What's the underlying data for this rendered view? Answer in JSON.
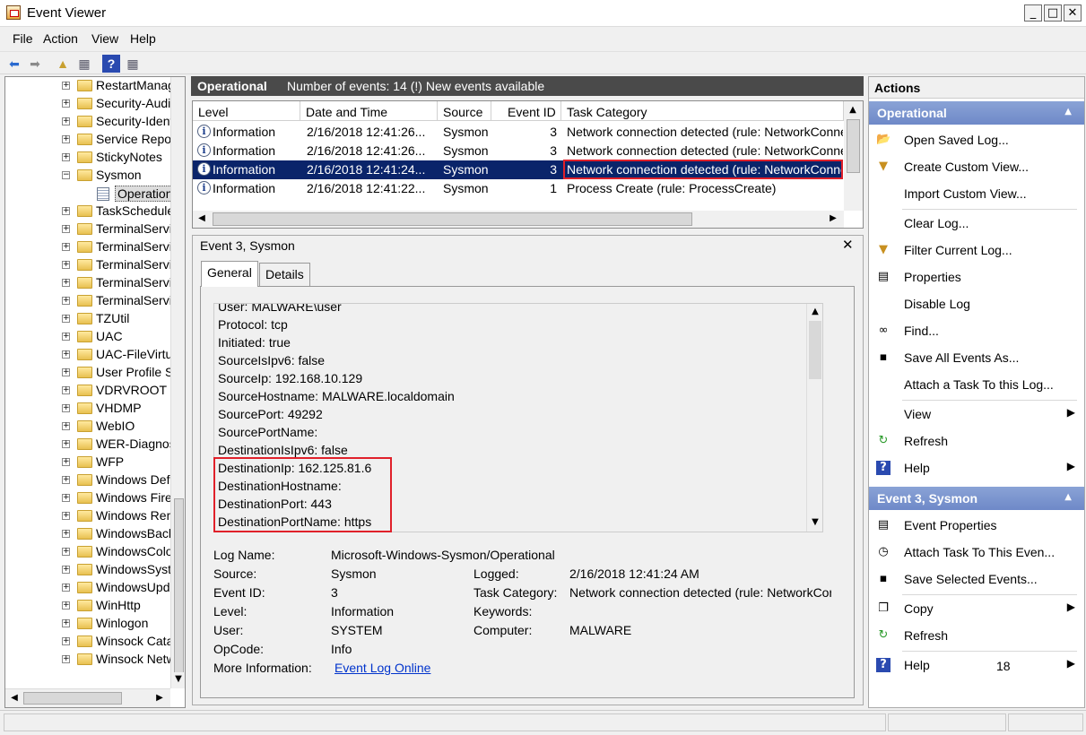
{
  "window": {
    "title": "Event Viewer"
  },
  "menu": [
    "File",
    "Action",
    "View",
    "Help"
  ],
  "tree": {
    "items": [
      {
        "label": "RestartManager",
        "expander": "+"
      },
      {
        "label": "Security-Auditing",
        "expander": "+"
      },
      {
        "label": "Security-IdentityListener",
        "expander": "+"
      },
      {
        "label": "Service Reporting API",
        "expander": "+"
      },
      {
        "label": "StickyNotes",
        "expander": "+"
      },
      {
        "label": "Sysmon",
        "expander": "−"
      },
      {
        "label": "Operational",
        "expander": ""
      },
      {
        "label": "TaskScheduler",
        "expander": "+"
      },
      {
        "label": "TerminalServices-ClientActiveX",
        "expander": "+"
      },
      {
        "label": "TerminalServices-ClientUSB",
        "expander": "+"
      },
      {
        "label": "TerminalServices-LocalSession",
        "expander": "+"
      },
      {
        "label": "TerminalServices-PnPDevices",
        "expander": "+"
      },
      {
        "label": "TerminalServices-RemoteConnection",
        "expander": "+"
      },
      {
        "label": "TZUtil",
        "expander": "+"
      },
      {
        "label": "UAC",
        "expander": "+"
      },
      {
        "label": "UAC-FileVirtualization",
        "expander": "+"
      },
      {
        "label": "User Profile Service",
        "expander": "+"
      },
      {
        "label": "VDRVROOT",
        "expander": "+"
      },
      {
        "label": "VHDMP",
        "expander": "+"
      },
      {
        "label": "WebIO",
        "expander": "+"
      },
      {
        "label": "WER-Diagnostics",
        "expander": "+"
      },
      {
        "label": "WFP",
        "expander": "+"
      },
      {
        "label": "Windows Defender",
        "expander": "+"
      },
      {
        "label": "Windows Firewall",
        "expander": "+"
      },
      {
        "label": "Windows Remote",
        "expander": "+"
      },
      {
        "label": "WindowsBackup",
        "expander": "+"
      },
      {
        "label": "WindowsColorSystem",
        "expander": "+"
      },
      {
        "label": "WindowsSystemAssessment",
        "expander": "+"
      },
      {
        "label": "WindowsUpdateClient",
        "expander": "+"
      },
      {
        "label": "WinHttp",
        "expander": "+"
      },
      {
        "label": "Winlogon",
        "expander": "+"
      },
      {
        "label": "Winsock Catalog",
        "expander": "+"
      },
      {
        "label": "Winsock Network",
        "expander": "+"
      }
    ]
  },
  "operational": {
    "title": "Operational",
    "count_text": "Number of events: 14 (!) New events available"
  },
  "event_list": {
    "columns": [
      "Level",
      "Date and Time",
      "Source",
      "Event ID",
      "Task Category"
    ],
    "rows": [
      {
        "level": "Information",
        "datetime": "2/16/2018 12:41:26...",
        "source": "Sysmon",
        "event_id": "3",
        "category": "Network connection detected (rule: NetworkConnect)"
      },
      {
        "level": "Information",
        "datetime": "2/16/2018 12:41:26...",
        "source": "Sysmon",
        "event_id": "3",
        "category": "Network connection detected (rule: NetworkConnect)"
      },
      {
        "level": "Information",
        "datetime": "2/16/2018 12:41:24...",
        "source": "Sysmon",
        "event_id": "3",
        "category": "Network connection detected (rule: NetworkConnect)"
      },
      {
        "level": "Information",
        "datetime": "2/16/2018 12:41:22...",
        "source": "Sysmon",
        "event_id": "1",
        "category": "Process Create (rule: ProcessCreate)"
      }
    ]
  },
  "detail": {
    "title": "Event 3, Sysmon",
    "tabs": [
      "General",
      "Details"
    ],
    "lines": [
      "User: MALWARE\\user",
      "Protocol: tcp",
      "Initiated: true",
      "SourceIsIpv6: false",
      "SourceIp: 192.168.10.129",
      "SourceHostname: MALWARE.localdomain",
      "SourcePort: 49292",
      "SourcePortName:",
      "DestinationIsIpv6: false",
      "DestinationIp: 162.125.81.6",
      "DestinationHostname:",
      "DestinationPort: 443",
      "DestinationPortName: https"
    ],
    "info": {
      "log_name_label": "Log Name:",
      "log_name": "Microsoft-Windows-Sysmon/Operational",
      "source_label": "Source:",
      "source": "Sysmon",
      "logged_label": "Logged:",
      "logged": "2/16/2018 12:41:24 AM",
      "event_id_label": "Event ID:",
      "event_id": "3",
      "task_label": "Task Category:",
      "task": "Network connection detected (rule: NetworkConnect)",
      "level_label": "Level:",
      "level": "Information",
      "keywords_label": "Keywords:",
      "user_label": "User:",
      "user": "SYSTEM",
      "computer_label": "Computer:",
      "computer": "MALWARE",
      "opcode_label": "OpCode:",
      "opcode": "Info",
      "more_label": "More Information:",
      "more_link": "Event Log Online"
    }
  },
  "actions": {
    "header": "Actions",
    "section1": "Operational",
    "items1": [
      {
        "label": "Open Saved Log...",
        "icon": "📂"
      },
      {
        "label": "Create Custom View...",
        "icon": "▼"
      },
      {
        "label": "Import Custom View...",
        "icon": ""
      },
      {
        "label": "Clear Log...",
        "icon": ""
      },
      {
        "label": "Filter Current Log...",
        "icon": "▼"
      },
      {
        "label": "Properties",
        "icon": "▤"
      },
      {
        "label": "Disable Log",
        "icon": ""
      },
      {
        "label": "Find...",
        "icon": "∞"
      },
      {
        "label": "Save All Events As...",
        "icon": "▪"
      },
      {
        "label": "Attach a Task To this Log...",
        "icon": ""
      },
      {
        "label": "View",
        "icon": ""
      },
      {
        "label": "Refresh",
        "icon": "↻"
      },
      {
        "label": "Help",
        "icon": "?"
      }
    ],
    "section2": "Event 3, Sysmon",
    "items2": [
      {
        "label": "Event Properties",
        "icon": "▤"
      },
      {
        "label": "Attach Task To This Even...",
        "icon": "◷"
      },
      {
        "label": "Save Selected Events...",
        "icon": "▪"
      },
      {
        "label": "Copy",
        "icon": "❐"
      },
      {
        "label": "Refresh",
        "icon": "↻"
      },
      {
        "label": "Help",
        "icon": "?"
      }
    ],
    "page_number": "18"
  }
}
